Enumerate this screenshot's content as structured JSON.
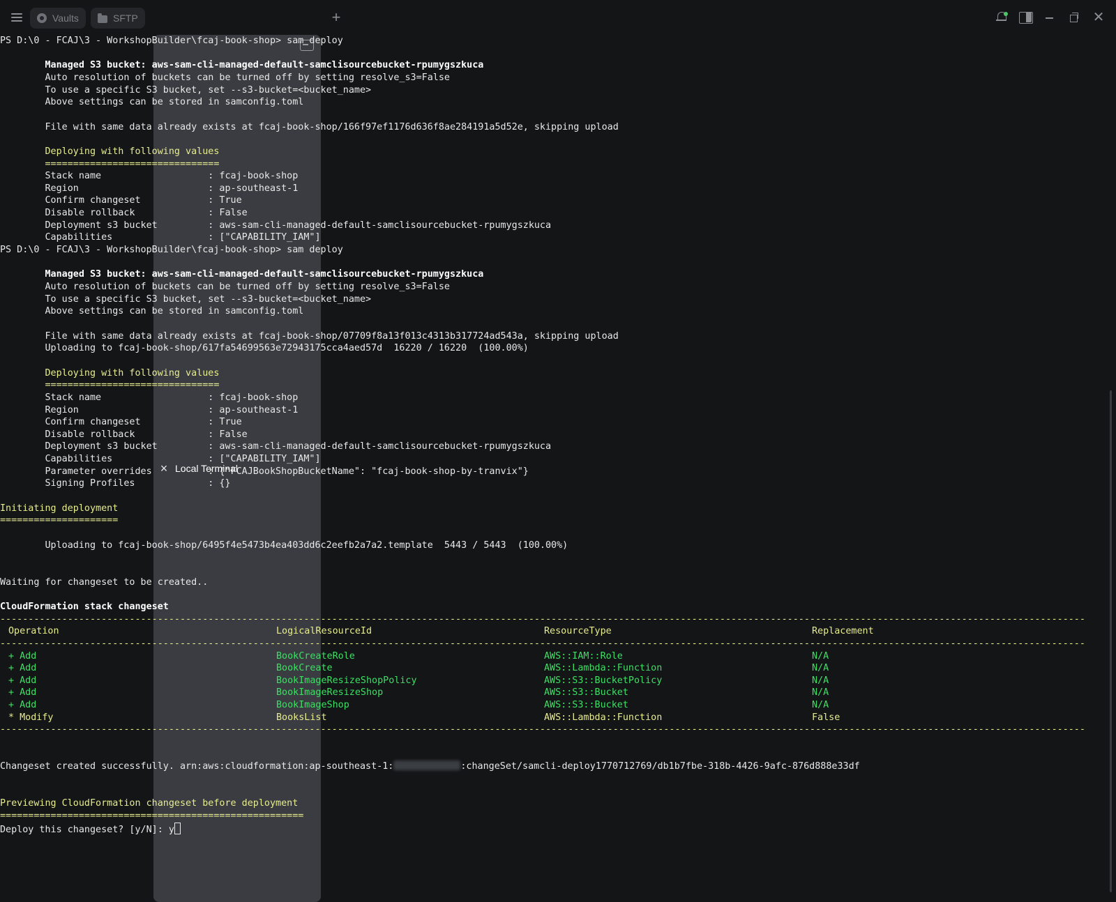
{
  "tabs": {
    "vaults": "Vaults",
    "sftp": "SFTP",
    "terminal": "Local Terminal"
  },
  "icons": [
    "menu-icon",
    "vault-icon",
    "folder-icon",
    "close-icon",
    "terminal-icon",
    "plus-icon",
    "bell-icon",
    "panel-icon",
    "minimize-icon",
    "restore-icon",
    "close-window-icon"
  ],
  "colors": {
    "background": "#141517",
    "yellow": "#e7ec8f",
    "green": "#3fdf65",
    "active_tab": "#3a3c41"
  },
  "terminal": {
    "lines": [
      {
        "t": "PS D:\\0 - FCAJ\\3 - WorkshopBuilder\\fcaj-book-shop> sam deploy"
      },
      {
        "t": ""
      },
      {
        "t": "        Managed S3 bucket: aws-sam-cli-managed-default-samclisourcebucket-rpumygszkuca",
        "s": "b"
      },
      {
        "t": "        Auto resolution of buckets can be turned off by setting resolve_s3=False"
      },
      {
        "t": "        To use a specific S3 bucket, set --s3-bucket=<bucket_name>"
      },
      {
        "t": "        Above settings can be stored in samconfig.toml"
      },
      {
        "t": ""
      },
      {
        "t": "        File with same data already exists at fcaj-book-shop/166f97ef1176d636f8ae284191a5d52e, skipping upload"
      },
      {
        "t": ""
      },
      {
        "t": "        Deploying with following values",
        "s": "y"
      },
      {
        "t": "        ===============================",
        "s": "y"
      },
      {
        "t": "        Stack name                   : fcaj-book-shop"
      },
      {
        "t": "        Region                       : ap-southeast-1"
      },
      {
        "t": "        Confirm changeset            : True"
      },
      {
        "t": "        Disable rollback             : False"
      },
      {
        "t": "        Deployment s3 bucket         : aws-sam-cli-managed-default-samclisourcebucket-rpumygszkuca"
      },
      {
        "t": "        Capabilities                 : [\"CAPABILITY_IAM\"]"
      },
      {
        "t": "PS D:\\0 - FCAJ\\3 - WorkshopBuilder\\fcaj-book-shop> sam deploy"
      },
      {
        "t": ""
      },
      {
        "t": "        Managed S3 bucket: aws-sam-cli-managed-default-samclisourcebucket-rpumygszkuca",
        "s": "b"
      },
      {
        "t": "        Auto resolution of buckets can be turned off by setting resolve_s3=False"
      },
      {
        "t": "        To use a specific S3 bucket, set --s3-bucket=<bucket_name>"
      },
      {
        "t": "        Above settings can be stored in samconfig.toml"
      },
      {
        "t": ""
      },
      {
        "t": "        File with same data already exists at fcaj-book-shop/07709f8a13f013c4313b317724ad543a, skipping upload"
      },
      {
        "t": "        Uploading to fcaj-book-shop/617fa54699563e72943175cca4aed57d  16220 / 16220  (100.00%)"
      },
      {
        "t": ""
      },
      {
        "t": "        Deploying with following values",
        "s": "y"
      },
      {
        "t": "        ===============================",
        "s": "y"
      },
      {
        "t": "        Stack name                   : fcaj-book-shop"
      },
      {
        "t": "        Region                       : ap-southeast-1"
      },
      {
        "t": "        Confirm changeset            : True"
      },
      {
        "t": "        Disable rollback             : False"
      },
      {
        "t": "        Deployment s3 bucket         : aws-sam-cli-managed-default-samclisourcebucket-rpumygszkuca"
      },
      {
        "t": "        Capabilities                 : [\"CAPABILITY_IAM\"]"
      },
      {
        "t": "        Parameter overrides          : {\"FCAJBookShopBucketName\": \"fcaj-book-shop-by-tranvix\"}"
      },
      {
        "t": "        Signing Profiles             : {}"
      },
      {
        "t": ""
      },
      {
        "t": "Initiating deployment",
        "s": "y"
      },
      {
        "t": "=====================",
        "s": "y"
      },
      {
        "t": ""
      },
      {
        "t": "        Uploading to fcaj-book-shop/6495f4e5473b4ea403dd6c2eefb2a7a2.template  5443 / 5443  (100.00%)"
      },
      {
        "t": ""
      },
      {
        "t": ""
      },
      {
        "t": "Waiting for changeset to be created.."
      },
      {
        "t": ""
      },
      {
        "t": "CloudFormation stack changeset",
        "s": "b"
      }
    ],
    "changeset": {
      "rule": "-------------------------------------------------------------------------------------------------------------------------------------------------------------------------------------------------",
      "headers": [
        "Operation",
        "LogicalResourceId",
        "ResourceType",
        "Replacement"
      ],
      "rows": [
        [
          "+ Add",
          "BookCreateRole",
          "AWS::IAM::Role",
          "N/A"
        ],
        [
          "+ Add",
          "BookCreate",
          "AWS::Lambda::Function",
          "N/A"
        ],
        [
          "+ Add",
          "BookImageResizeShopPolicy",
          "AWS::S3::BucketPolicy",
          "N/A"
        ],
        [
          "+ Add",
          "BookImageResizeShop",
          "AWS::S3::Bucket",
          "N/A"
        ],
        [
          "+ Add",
          "BookImageShop",
          "AWS::S3::Bucket",
          "N/A"
        ],
        [
          "* Modify",
          "BooksList",
          "AWS::Lambda::Function",
          "False"
        ]
      ]
    },
    "success_prefix": "Changeset created successfully. arn:aws:cloudformation:ap-southeast-1:",
    "success_suffix": ":changeSet/samcli-deploy1770712769/db1b7fbe-318b-4426-9afc-876d888e33df",
    "preview_title": "Previewing CloudFormation changeset before deployment",
    "preview_rule": "======================================================",
    "prompt": "Deploy this changeset? [y/N]: ",
    "input_value": "y"
  }
}
